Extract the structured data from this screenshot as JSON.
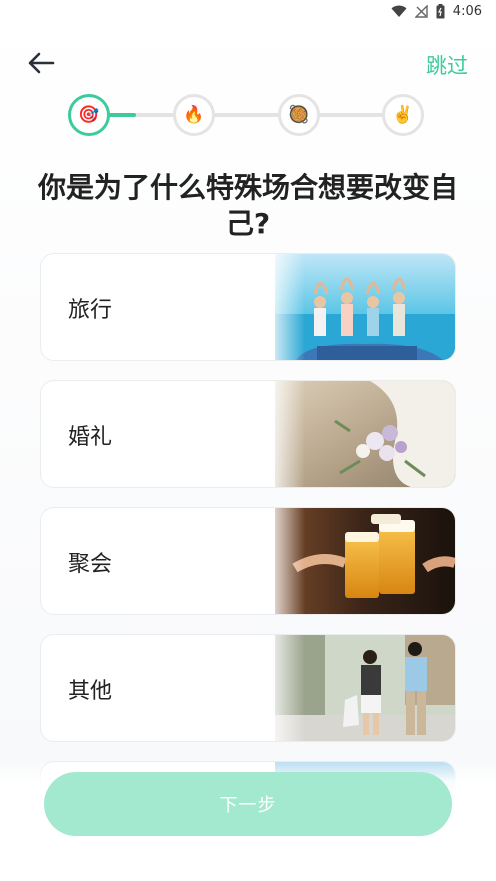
{
  "status_bar": {
    "time": "4:06",
    "icons": [
      "wifi-icon",
      "no-signal-icon",
      "battery-icon"
    ]
  },
  "header": {
    "back_icon": "arrow-left-icon",
    "skip_label": "跳过"
  },
  "stepper": {
    "active_index": 0,
    "steps": [
      {
        "icon": "target-icon",
        "glyph": "🎯"
      },
      {
        "icon": "fire-icon",
        "glyph": "🔥"
      },
      {
        "icon": "food-bowl-icon",
        "glyph": "🥘"
      },
      {
        "icon": "victory-hand-icon",
        "glyph": "✌️"
      }
    ]
  },
  "question": "你是为了什么特殊场合想要改变自己?",
  "options": [
    {
      "label": "旅行",
      "image": "travel-photo"
    },
    {
      "label": "婚礼",
      "image": "wedding-bouquet-photo"
    },
    {
      "label": "聚会",
      "image": "beer-toast-photo"
    },
    {
      "label": "其他",
      "image": "couple-walking-photo"
    }
  ],
  "next_button": {
    "label": "下一步"
  },
  "colors": {
    "accent": "#3ecb9b",
    "button_disabled": "#a3e9cf",
    "title": "#222222"
  }
}
